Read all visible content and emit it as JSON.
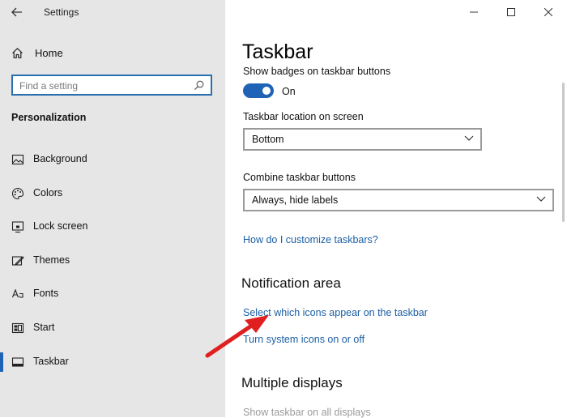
{
  "window": {
    "title": "Settings"
  },
  "sidebar": {
    "home_label": "Home",
    "search_placeholder": "Find a setting",
    "section_title": "Personalization",
    "items": [
      {
        "label": "Background",
        "icon": "picture-icon",
        "active": false
      },
      {
        "label": "Colors",
        "icon": "palette-icon",
        "active": false
      },
      {
        "label": "Lock screen",
        "icon": "lock-screen-icon",
        "active": false
      },
      {
        "label": "Themes",
        "icon": "themes-icon",
        "active": false
      },
      {
        "label": "Fonts",
        "icon": "fonts-icon",
        "active": false
      },
      {
        "label": "Start",
        "icon": "start-icon",
        "active": false
      },
      {
        "label": "Taskbar",
        "icon": "taskbar-icon",
        "active": true
      }
    ]
  },
  "content": {
    "page_title": "Taskbar",
    "badges_label": "Show badges on taskbar buttons",
    "badges_state": "On",
    "location_label": "Taskbar location on screen",
    "location_value": "Bottom",
    "combine_label": "Combine taskbar buttons",
    "combine_value": "Always, hide labels",
    "customize_link": "How do I customize taskbars?",
    "notification_heading": "Notification area",
    "select_icons_link": "Select which icons appear on the taskbar",
    "system_icons_link": "Turn system icons on or off",
    "multiple_displays_heading": "Multiple displays",
    "show_all_displays_label": "Show taskbar on all displays"
  },
  "colors": {
    "accent": "#1e63b5",
    "link": "#1b5fa3",
    "sidebar_bg": "#e6e6e6",
    "annotation_arrow": "#e02020"
  }
}
